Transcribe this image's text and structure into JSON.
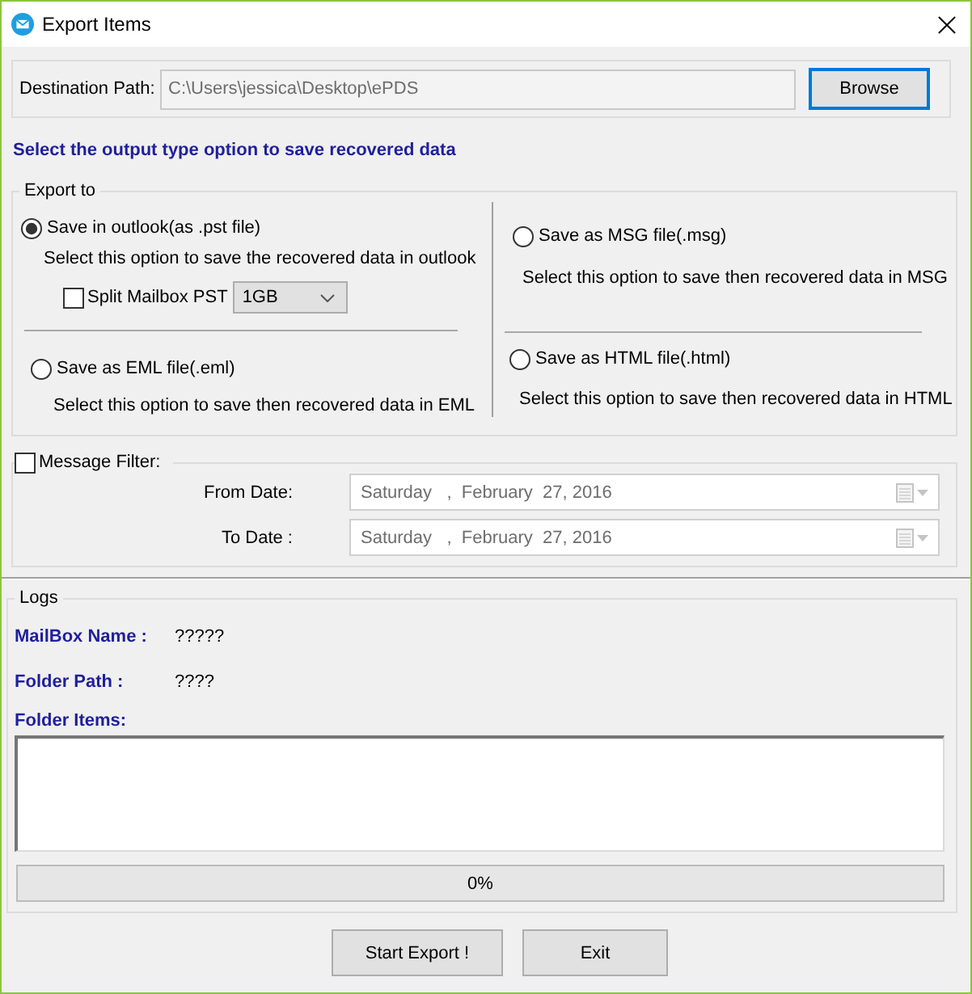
{
  "window": {
    "title": "Export Items"
  },
  "destination": {
    "label": "Destination Path:",
    "value": "C:\\Users\\jessica\\Desktop\\ePDS",
    "disabled": true,
    "button": {
      "label": "Browse",
      "focused": true
    }
  },
  "heading": "Select the output type option to save recovered data",
  "export_to": {
    "legend": "Export to",
    "columns": [
      {
        "options": [
          {
            "label": "Save in outlook(as .pst file)",
            "description": "Select this option to save the recovered data in outlook",
            "selected": true,
            "split": {
              "label": "Split Mailbox PST",
              "checked": false,
              "size": "1GB"
            }
          },
          {
            "label": "Save as EML file(.eml)",
            "description": "Select this option to save then recovered data in EML",
            "selected": false
          }
        ]
      },
      {
        "options": [
          {
            "label": "Save as MSG file(.msg)",
            "description": "Select this option to save then recovered data in MSG",
            "selected": false
          },
          {
            "label": "Save as HTML file(.html)",
            "description": "Select this option to save then recovered data in HTML",
            "selected": false
          }
        ]
      }
    ]
  },
  "message_filter": {
    "label": "Message Filter:",
    "checked": false,
    "fields": [
      {
        "label": "From Date:",
        "value": "Saturday   ,  February  27, 2016"
      },
      {
        "label": "To Date :",
        "value": "Saturday   ,  February  27, 2016"
      }
    ]
  },
  "logs": {
    "legend": "Logs",
    "entries": [
      {
        "label": "MailBox Name :",
        "value": "?????"
      },
      {
        "label": "Folder Path :",
        "value": "????"
      }
    ],
    "items_label": "Folder Items:",
    "progress": {
      "level": 0,
      "text": "0%"
    }
  },
  "buttons": [
    "Start Export !",
    "Exit"
  ]
}
